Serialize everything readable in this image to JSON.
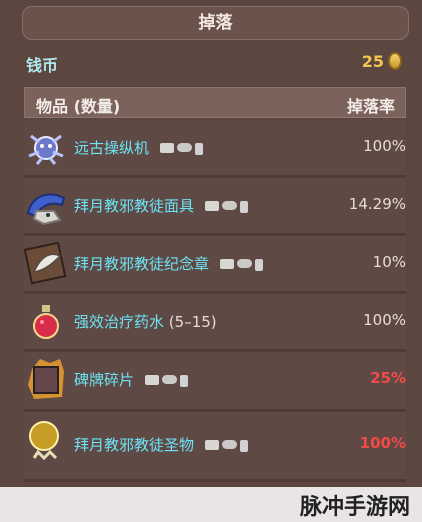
{
  "header": {
    "title": "掉落"
  },
  "coins": {
    "label": "钱币",
    "amount": "25"
  },
  "columns": {
    "item": "物品 (数量)",
    "rate": "掉落率"
  },
  "rows": [
    {
      "name": "远古操纵机",
      "qty": "",
      "rate": "100%",
      "rate_color": "#e6ddd8"
    },
    {
      "name": "拜月教邪教徒面具",
      "qty": "",
      "rate": "14.29%",
      "rate_color": "#e6ddd8"
    },
    {
      "name": "拜月教邪教徒纪念章",
      "qty": "",
      "rate": "10%",
      "rate_color": "#e6ddd8"
    },
    {
      "name": "强效治疗药水",
      "qty": "(5–15)",
      "rate": "100%",
      "rate_color": "#e6ddd8"
    },
    {
      "name": "碑牌碎片",
      "qty": "",
      "rate": "25%",
      "rate_color": "#f24a46"
    },
    {
      "name": "拜月教邪教徒圣物",
      "qty": "",
      "rate": "100%",
      "rate_color": "#f24a46"
    }
  ],
  "watermark": "脉冲手游网"
}
